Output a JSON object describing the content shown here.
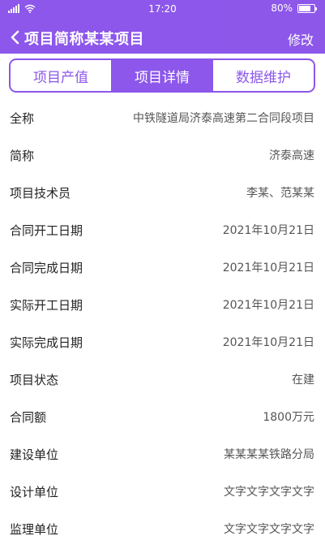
{
  "status_bar": {
    "time": "17:20",
    "battery": "80%",
    "battery_level": 0.8,
    "icons": [
      "signal-icon",
      "wifi-icon",
      "battery-icon"
    ]
  },
  "nav": {
    "title": "项目简称某某项目",
    "edit_label": "修改",
    "back_icon": "chevron-left-icon"
  },
  "tabs": [
    {
      "label": "项目产值",
      "active": false
    },
    {
      "label": "项目详情",
      "active": true
    },
    {
      "label": "数据维护",
      "active": false
    }
  ],
  "details": [
    {
      "label": "全称",
      "value": "中铁隧道局济泰高速第二合同段项目"
    },
    {
      "label": "简称",
      "value": "济泰高速"
    },
    {
      "label": "项目技术员",
      "value": "李某、范某某"
    },
    {
      "label": "合同开工日期",
      "value": "2021年10月21日"
    },
    {
      "label": "合同完成日期",
      "value": "2021年10月21日"
    },
    {
      "label": "实际开工日期",
      "value": "2021年10月21日"
    },
    {
      "label": "实际完成日期",
      "value": "2021年10月21日"
    },
    {
      "label": "项目状态",
      "value": "在建"
    },
    {
      "label": "合同额",
      "value": "1800万元"
    },
    {
      "label": "建设单位",
      "value": "某某某某铁路分局"
    },
    {
      "label": "设计单位",
      "value": "文字文字文字文字"
    },
    {
      "label": "监理单位",
      "value": "文字文字文字文字"
    }
  ],
  "colors": {
    "accent": "#8c57ea",
    "text": "#222222",
    "value_text": "#555555"
  }
}
